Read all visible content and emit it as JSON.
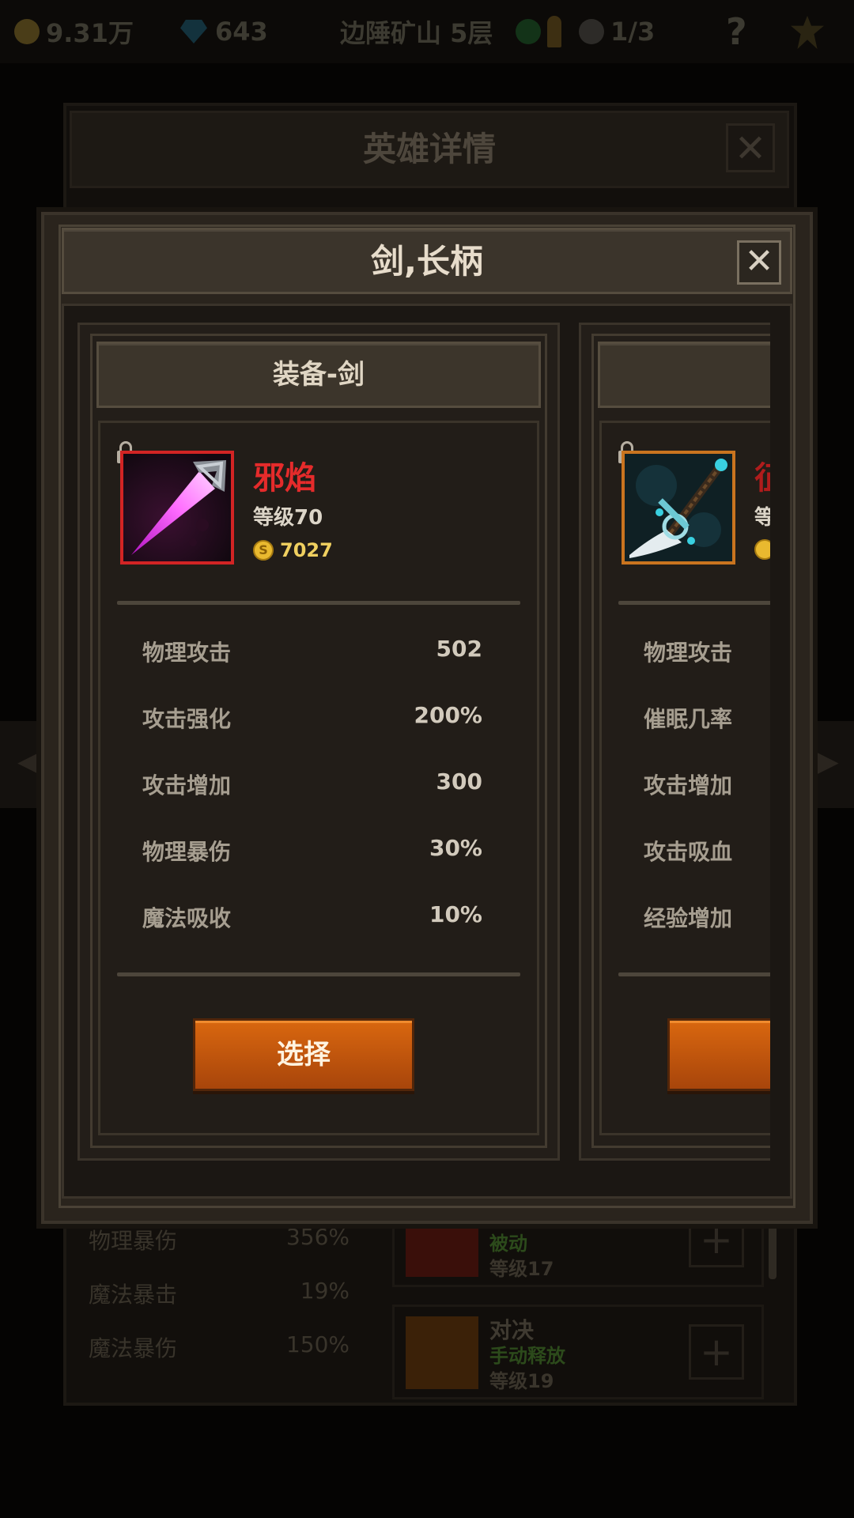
{
  "topbar": {
    "gold": "9.31万",
    "gems": "643",
    "location": "边陲矿山 5层",
    "skull_count": "1/3",
    "help": "?"
  },
  "background_panel": {
    "title": "英雄详情",
    "close": "✕",
    "stats": [
      {
        "label": "物理暴伤",
        "value": "356%"
      },
      {
        "label": "魔法暴击",
        "value": "19%"
      },
      {
        "label": "魔法暴伤",
        "value": "150%"
      }
    ],
    "skills": [
      {
        "name": "",
        "type": "被动",
        "level": "等级17"
      },
      {
        "name": "对决",
        "type": "手动释放",
        "level": "等级19"
      }
    ],
    "plus": "+"
  },
  "dialog": {
    "title": "剑,长柄",
    "close": "✕"
  },
  "cards": [
    {
      "header": "装备-剑",
      "item_name": "邪焰",
      "item_name_color": "#e52b2b",
      "level": "等级70",
      "price": "7027",
      "coin_symbol": "S",
      "stats": [
        {
          "label": "物理攻击",
          "value": "502"
        },
        {
          "label": "攻击强化",
          "value": "200%"
        },
        {
          "label": "攻击增加",
          "value": "300"
        },
        {
          "label": "物理暴伤",
          "value": "30%"
        },
        {
          "label": "魔法吸收",
          "value": "10%"
        }
      ],
      "button": "选择",
      "icon": "purple-blade-icon",
      "locked": true
    },
    {
      "header": "",
      "item_name": "征",
      "level": "等",
      "stats": [
        {
          "label": "物理攻击"
        },
        {
          "label": "催眠几率"
        },
        {
          "label": "攻击增加"
        },
        {
          "label": "攻击吸血"
        },
        {
          "label": "经验增加"
        }
      ],
      "button": "",
      "icon": "cyan-sword-icon",
      "locked": true
    }
  ],
  "colors": {
    "accent_button": "#d9670f",
    "rare_border": "#d22424",
    "epic_border": "#c9741f",
    "gold_text": "#f0d060"
  }
}
